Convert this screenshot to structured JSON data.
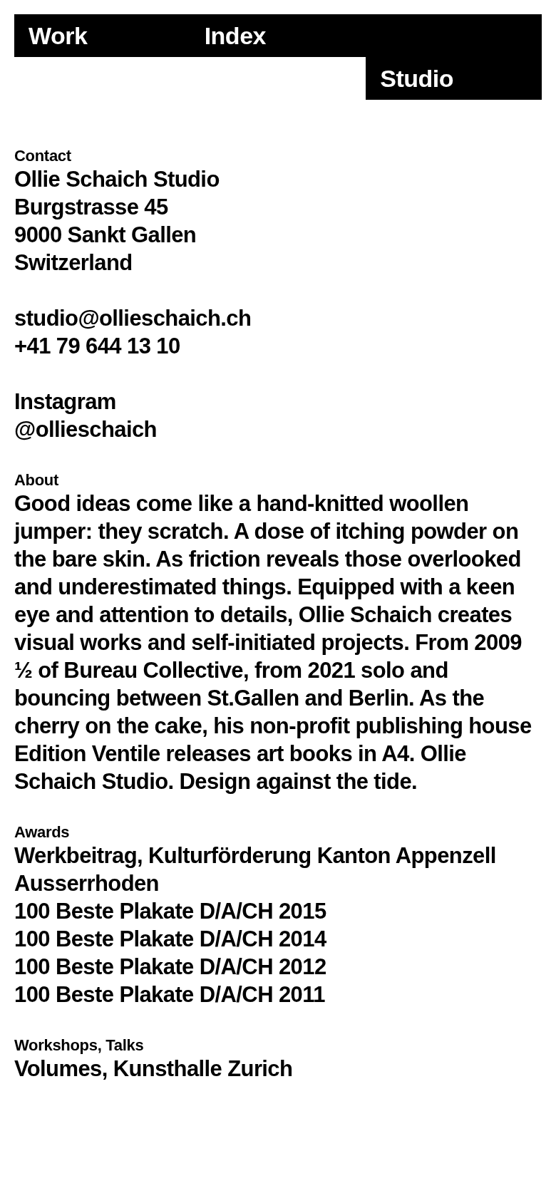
{
  "nav": [
    {
      "label": "Work",
      "selected": false
    },
    {
      "label": "Index",
      "selected": false
    },
    {
      "label": "Studio",
      "selected": true
    }
  ],
  "sections": [
    {
      "heading": "Contact",
      "kind": "groups",
      "groups": [
        [
          "Ollie Schaich Studio",
          "Burgstrasse 45",
          "9000 Sankt Gallen",
          "Switzerland"
        ],
        [
          "studio@ollieschaich.ch",
          "+41 79 644 13 10"
        ],
        [
          "Instagram",
          "@ollieschaich"
        ]
      ]
    },
    {
      "heading": "About",
      "kind": "paragraph",
      "text": "Good ideas come like a hand-knitted woollen jumper: they scratch. A dose of itching powder on the bare skin. As friction reveals those overlooked and underestimated things. Equipped with a keen eye and attention to details, Ollie Schaich creates visual works and self-initiated projects. From 2009 ½ of Bureau Collective, from 2021 solo and bouncing between St.Gallen and Berlin. As the cherry on the cake, his non-profit publishing house Edition Ventile releases art books in A4. Ollie Schaich Studio. Design against the tide."
    },
    {
      "heading": "Awards",
      "kind": "list",
      "items": [
        "Werkbeitrag, Kulturförderung Kanton Appenzell Ausserrhoden",
        "100 Beste Plakate D/A/CH 2015",
        "100 Beste Plakate D/A/CH 2014",
        "100 Beste Plakate D/A/CH 2012",
        "100 Beste Plakate D/A/CH 2011"
      ]
    },
    {
      "heading": "Workshops, Talks",
      "kind": "list",
      "items": [
        "Volumes, Kunsthalle Zurich"
      ]
    }
  ]
}
